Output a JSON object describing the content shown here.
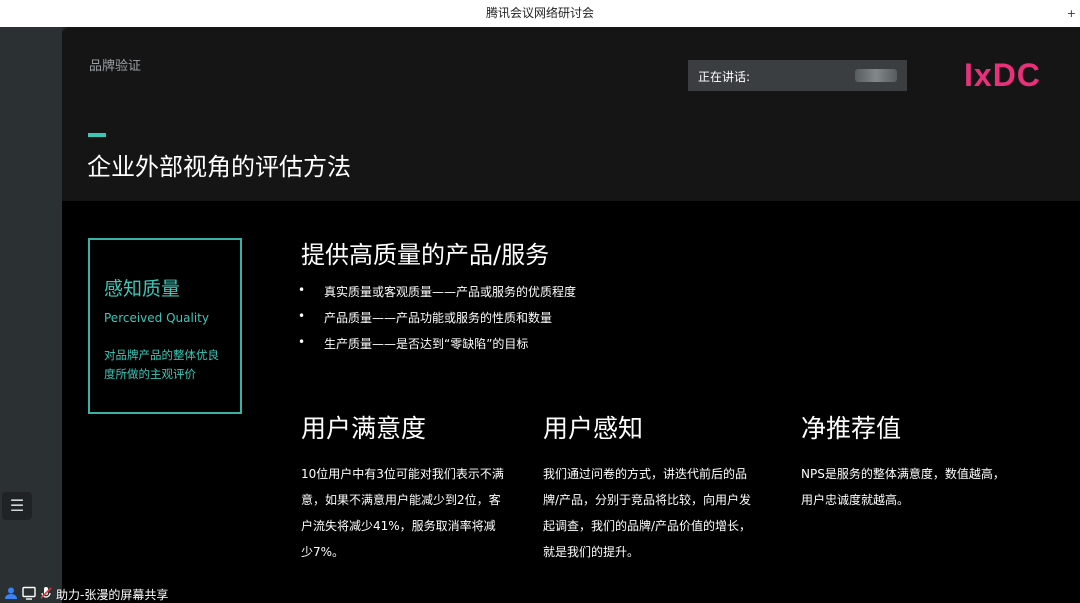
{
  "window": {
    "title": "腾讯会议网络研讨会",
    "pin": "+"
  },
  "sidebar": {
    "list_icon": "☰"
  },
  "slide": {
    "section_label": "品牌验证",
    "speaker_label": "正在讲话:",
    "logo": "IxDC",
    "title": "企业外部视角的评估方法",
    "quality_box": {
      "title": "感知质量",
      "subtitle": "Perceived Quality",
      "description": "对品牌产品的整体优良度所做的主观评价"
    },
    "offer": {
      "title": "提供高质量的产品/服务",
      "bullets": [
        "真实质量或客观质量——产品或服务的优质程度",
        "产品质量——产品功能或服务的性质和数量",
        "生产质量——是否达到“零缺陷”的目标"
      ]
    },
    "columns": [
      {
        "heading": "用户满意度",
        "text": "10位用户中有3位可能对我们表示不满意，如果不满意用户能减少到2位，客户流失将减少41%，服务取消率将减少7%。"
      },
      {
        "heading": "用户感知",
        "text": "我们通过问卷的方式，讲迭代前后的品牌/产品，分别于竞品将比较，向用户发起调查，我们的品牌/产品价值的增长，就是我们的提升。"
      },
      {
        "heading": "净推荐值",
        "text": "NPS是服务的整体满意度，数值越高，用户忠诚度就越高。"
      }
    ]
  },
  "footer": {
    "share_text": "助力-张漫的屏幕共享"
  },
  "colors": {
    "accent": "#3cc6b8",
    "logo": "#e8317a"
  }
}
